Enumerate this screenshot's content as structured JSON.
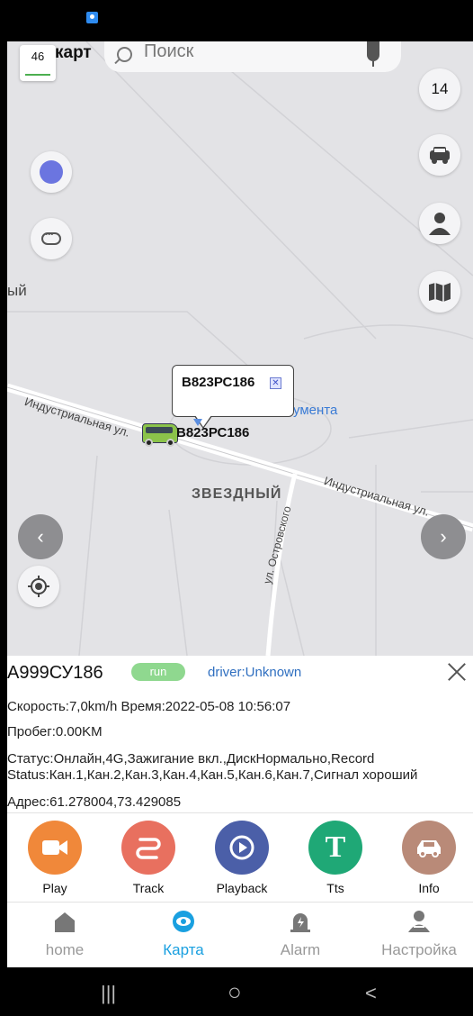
{
  "map": {
    "zoom_level": "46",
    "brand_cut": "карт",
    "search": {
      "placeholder": "Поиск"
    },
    "right_zoom": "14",
    "label_left_cut": "ый",
    "street_1": "Индустриальная ул.",
    "street_2": "Индустриальная ул.",
    "district": "ЗВЕЗДНЫЙ",
    "street_3": "ул. Островского",
    "poi_cut": "умента",
    "popup_plate": "В823РС186",
    "popup_close": "✕",
    "vehicle_label": "В823РС186"
  },
  "info": {
    "plate": "А999СУ186",
    "status_badge": "run",
    "driver": "driver:Unknown",
    "speed_line": "Скорость:7,0km/h  Время:2022-05-08 10:56:07",
    "mileage_line": "Пробег:0.00KM",
    "status_line1": "Статус:Онлайн,4G,Зажигание вкл.,ДискНормально,Record",
    "status_line2": "Status:Кан.1,Кан.2,Кан.3,Кан.4,Кан.5,Кан.6,Кан.7,Сигнал хороший",
    "address_line": "Адрес:61.278004,73.429085"
  },
  "actions": [
    {
      "label": "Play",
      "color": "#f0883a",
      "icon": "video-camera-icon"
    },
    {
      "label": "Track",
      "color": "#e8705f",
      "icon": "track-route-icon"
    },
    {
      "label": "Playback",
      "color": "#4b5fa8",
      "icon": "replay-icon"
    },
    {
      "label": "Tts",
      "color": "#1fa876",
      "icon": "text-t-icon"
    },
    {
      "label": "Info",
      "color": "#b98a78",
      "icon": "car-info-icon"
    }
  ],
  "tabs": [
    {
      "label": "home",
      "icon": "home-icon",
      "active": false
    },
    {
      "label": "Карта",
      "icon": "eye-icon",
      "active": true
    },
    {
      "label": "Alarm",
      "icon": "alarm-icon",
      "active": false
    },
    {
      "label": "Настройка",
      "icon": "user-settings-icon",
      "active": false
    }
  ],
  "colors": {
    "accent": "#1aa0e0",
    "run_badge": "#8fd88f",
    "driver_link": "#2f6fc0"
  },
  "system_nav": {
    "recent": "|||",
    "home": "○",
    "back": "<"
  }
}
